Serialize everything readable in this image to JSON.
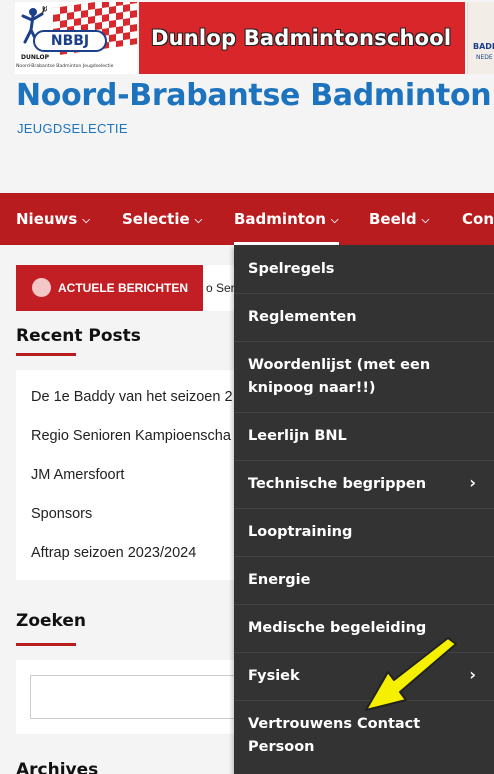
{
  "header": {
    "logo_text": "NBBJ",
    "logo_caption": "Noord-Brabantse Badminton Jeugdselectie",
    "logo_sponsor": "DUNLOP",
    "banner_title": "Dunlop Badmintonschool",
    "partner_text_1": "BADMIN",
    "partner_text_2": "NEDE",
    "site_title": "Noord-Brabantse Badminton",
    "tagline": "JEUGDSELECTIE"
  },
  "nav": {
    "items": [
      {
        "label": "Nieuws"
      },
      {
        "label": "Selectie"
      },
      {
        "label": "Badminton"
      },
      {
        "label": "Beeld"
      },
      {
        "label": "Cont"
      }
    ]
  },
  "ticker": {
    "label": "ACTUELE BERICHTEN",
    "text": "o Ser"
  },
  "recent_posts": {
    "title": "Recent Posts",
    "items": [
      "De 1e Baddy van het seizoen 2",
      "Regio Senioren Kampioenscha",
      "JM Amersfoort",
      "Sponsors",
      "Aftrap seizoen 2023/2024"
    ]
  },
  "search": {
    "title": "Zoeken"
  },
  "archives": {
    "title": "Archives"
  },
  "dropdown": {
    "items": [
      {
        "label": "Spelregels"
      },
      {
        "label": "Reglementen"
      },
      {
        "label": "Woordenlijst (met een knipoog naar!!)"
      },
      {
        "label": "Leerlijn BNL"
      },
      {
        "label": "Technische begrippen"
      },
      {
        "label": "Looptraining"
      },
      {
        "label": "Energie"
      },
      {
        "label": "Medische begeleiding"
      },
      {
        "label": "Fysiek"
      },
      {
        "label": "Vertrouwens Contact Persoon"
      }
    ]
  },
  "colors": {
    "nav_red": "#b91c1f",
    "banner_red": "#d8262b",
    "title_blue": "#1e73be",
    "dropdown_bg": "#333333",
    "arrow_yellow": "#f5f000"
  },
  "icons": [
    "chevron-down-icon",
    "chevron-right-icon",
    "yellow-arrow-annotation"
  ]
}
